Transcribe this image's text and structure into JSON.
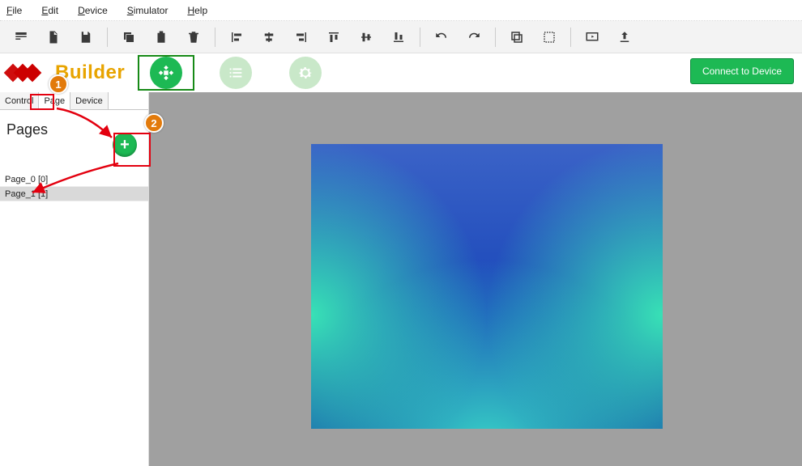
{
  "menu": {
    "file": "File",
    "edit": "Edit",
    "device": "Device",
    "simulator": "Simulator",
    "help": "Help"
  },
  "branding": {
    "title": "Builder"
  },
  "connect": {
    "label": "Connect to Device"
  },
  "sidebar": {
    "tabs": {
      "control": "Control",
      "page": "Page",
      "device": "Device"
    },
    "title": "Pages",
    "add_label": "+",
    "items": [
      {
        "label": "Page_0 [0]"
      },
      {
        "label": "Page_1 [1]"
      }
    ]
  },
  "annotations": {
    "one": "1",
    "two": "2"
  }
}
